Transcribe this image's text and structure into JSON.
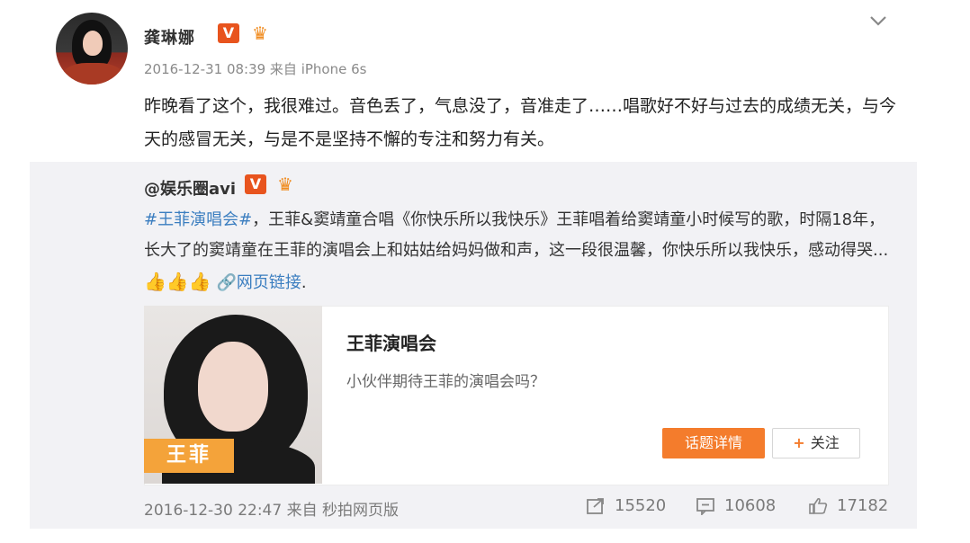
{
  "post": {
    "username": "龚琳娜",
    "verified_badge": "V",
    "vip_badge": "icon-vip-crown",
    "meta": "2016-12-31 08:39 来自 iPhone 6s",
    "text": "昨晚看了这个，我很难过。音色丢了，气息没了，音准走了……唱歌好不好与过去的成绩无关，与今天的感冒无关，与是不是坚持不懈的专注和努力有关。"
  },
  "repost": {
    "username": "@娱乐圈avi",
    "verified_badge": "V",
    "hashtag": "#王菲演唱会#",
    "text": "，王菲&窦靖童合唱《你快乐所以我快乐》王菲唱着给窦靖童小时候写的歌，时隔18年，长大了的窦靖童在王菲的演唱会上和姑姑给妈妈做和声，这一段很温馨，你快乐所以我快乐，感动得哭...",
    "thumbs": "👍👍👍",
    "link_label": "网页链接",
    "trailing": ".",
    "card": {
      "image_label": "王菲",
      "title": "王菲演唱会",
      "subtitle": "小伙伴期待王菲的演唱会吗？",
      "topic_button": "话题详情",
      "follow_button": "关注",
      "follow_plus": "+"
    },
    "meta": "2016-12-30 22:47 来自 秒拍网页版",
    "stats": {
      "forwards": "15520",
      "comments": "10608",
      "likes": "17182"
    }
  },
  "colors": {
    "accent_orange": "#f47c2c",
    "link_blue": "#3b7ec0",
    "verified_orange": "#e8541e"
  }
}
